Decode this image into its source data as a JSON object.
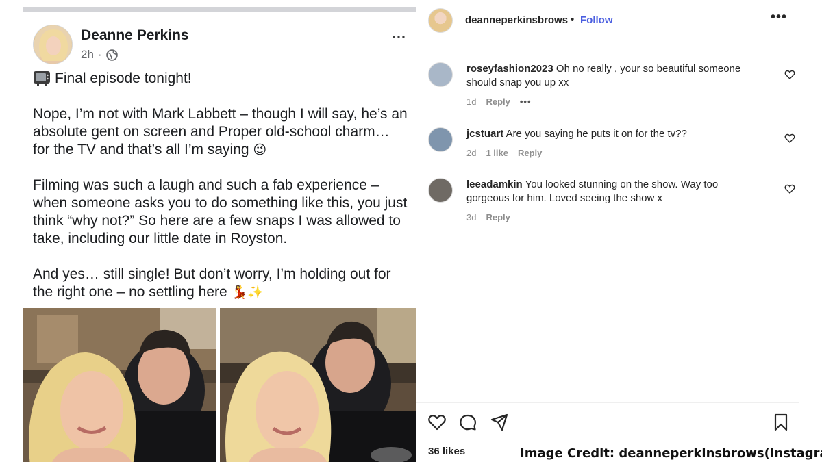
{
  "facebook_post": {
    "author": "Deanne Perkins",
    "time": "2h",
    "separator": "·",
    "more_icon": "…",
    "paragraphs": [
      {
        "text": "Final episode tonight!",
        "lead_icon": "tv-icon",
        "trail_emoji": ""
      },
      {
        "text": "Nope, I’m not with Mark Labbett – though I will say, he’s an absolute gent on screen and Proper old-school charm… for the TV and that’s all I’m saying",
        "lead_icon": "",
        "trail_emoji": "😉"
      },
      {
        "text": "Filming was such a laugh and such a fab experience – when someone asks you to do something like this, you just think “why not?” So here are a few snaps I was allowed to take, including our little date in Royston.",
        "lead_icon": "",
        "trail_emoji": ""
      },
      {
        "text": "And yes… still single! But don’t worry, I’m holding out for the right one – no settling here",
        "lead_icon": "",
        "trail_emoji": "💃✨"
      }
    ],
    "photo_count": 2
  },
  "instagram": {
    "username": "deanneperkinsbrows",
    "dot": "•",
    "follow_label": "Follow",
    "more_icon": "•••",
    "comments": [
      {
        "user": "roseyfashion2023",
        "text": "Oh no really , your so beautiful someone should snap you up xx",
        "time": "1d",
        "likes": "",
        "reply": "Reply",
        "more": "•••",
        "avatar_color": "#a9b7c8"
      },
      {
        "user": "jcstuart",
        "text": "Are you saying he puts it on for the tv??",
        "time": "2d",
        "likes": "1 like",
        "reply": "Reply",
        "more": "",
        "avatar_color": "#7f95ad"
      },
      {
        "user": "leeadamkin",
        "text": "You looked stunning on the show. Way too gorgeous for him. Loved seeing the show x",
        "time": "3d",
        "likes": "",
        "reply": "Reply",
        "more": "",
        "avatar_color": "#6f6a64"
      }
    ],
    "likes_count": "36 likes",
    "actions": [
      "heart-icon",
      "comment-icon",
      "share-icon",
      "bookmark-icon"
    ]
  },
  "credit": "Image Credit: deanneperkinsbrows(Instagram)"
}
